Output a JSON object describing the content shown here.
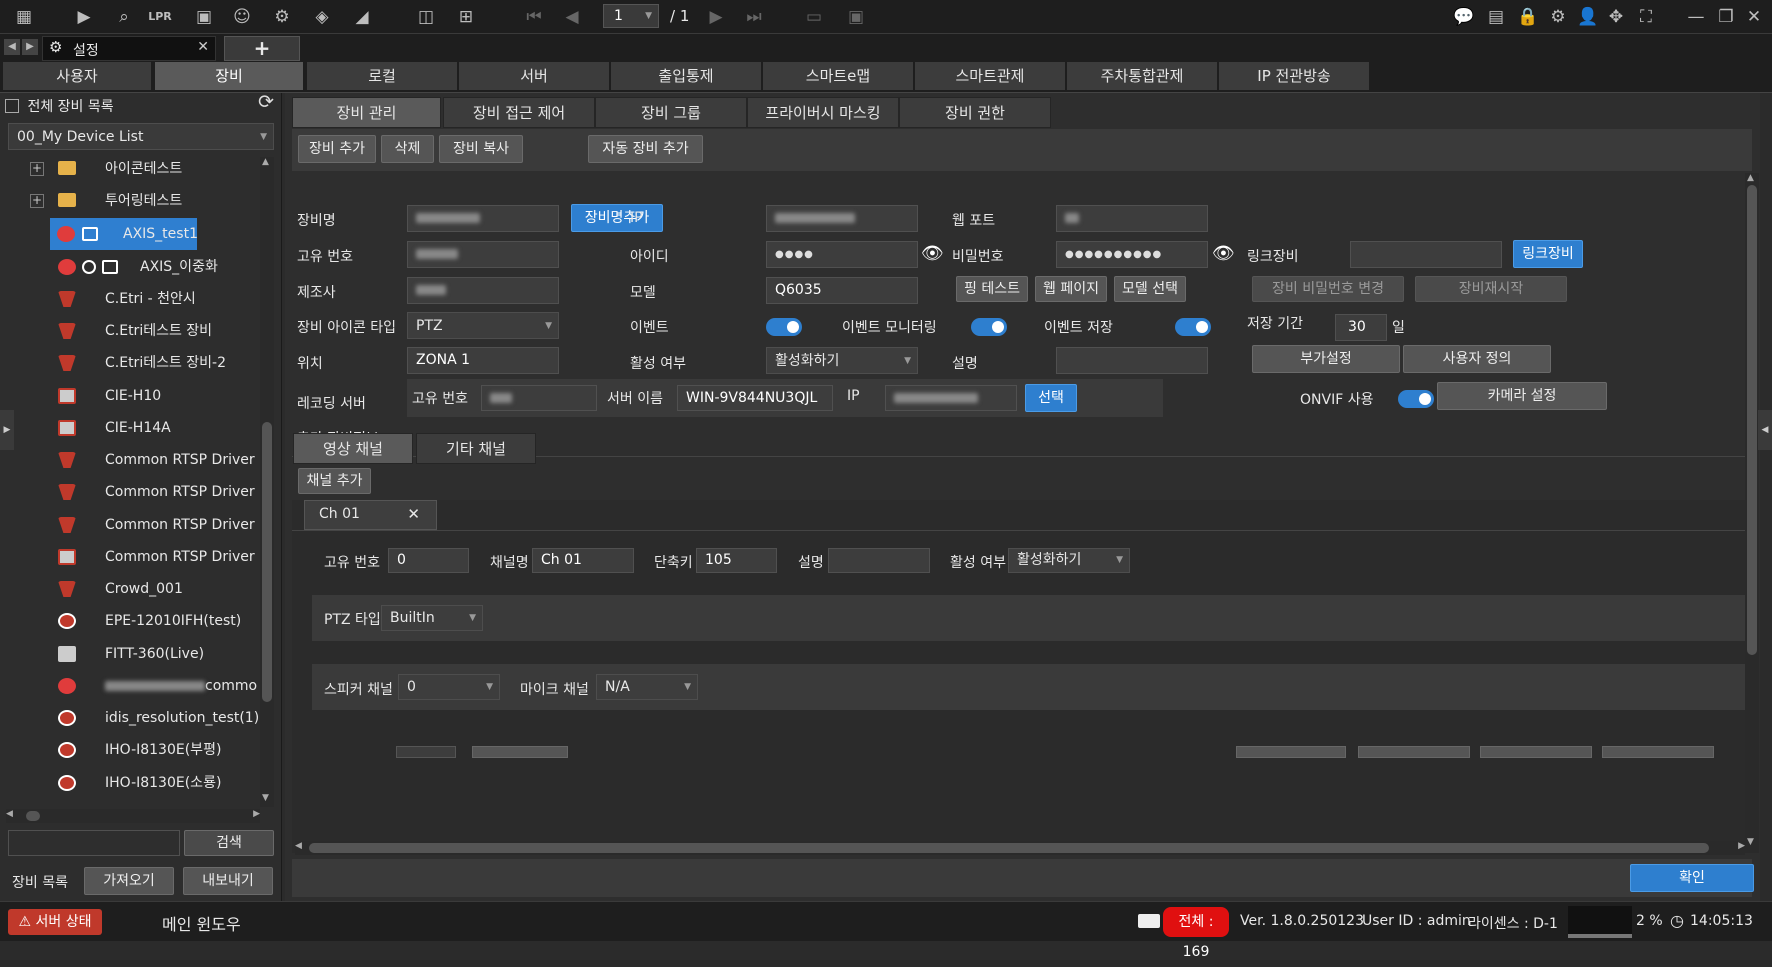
{
  "top": {
    "page": "1",
    "page_total": "/ 1"
  },
  "window_tab": {
    "title": "설정",
    "add": "+",
    "close": "✕"
  },
  "main_tabs": [
    "사용자",
    "장비",
    "로컬",
    "서버",
    "출입통제",
    "스마트e맵",
    "스마트관제",
    "주차통합관제",
    "IP 전관방송"
  ],
  "sidebar": {
    "all_devices": "전체 장비 목록",
    "device_list": "00_My Device List",
    "folders": [
      "아이콘테스트",
      "투어링테스트"
    ],
    "devices": [
      "AXIS_test1",
      "AXIS_이중화",
      "C.Etri - 천안시",
      "C.Etri테스트 장비",
      "C.Etri테스트 장비-2",
      "CIE-H10",
      "CIE-H14A",
      "Common RTSP Driver",
      "Common RTSP Driver",
      "Common RTSP Driver",
      "Common RTSP Driver",
      "Crowd_001",
      "EPE-12010IFH(test)",
      "FITT-360(Live)",
      "common",
      "idis_resolution_test(1)",
      "IHO-I8130E(부평)",
      "IHO-I8130E(소룡)"
    ],
    "search": "검색",
    "list_label": "장비 목록",
    "import": "가져오기",
    "export": "내보내기"
  },
  "sub_tabs": [
    "장비 관리",
    "장비 접근 제어",
    "장비 그룹",
    "프라이버시 마스킹",
    "장비 권한"
  ],
  "toolbar": {
    "add": "장비 추가",
    "delete": "삭제",
    "copy": "장비 복사",
    "auto_add": "자동 장비 추가"
  },
  "form": {
    "name_label": "장비명",
    "name_add": "장비명추가",
    "ip_label": "IP",
    "webport_label": "웹 포트",
    "uid_label": "고유 번호",
    "id_label": "아이디",
    "id_value": "●●●●",
    "pw_label": "비밀번호",
    "pw_value": "●●●●●●●●●●",
    "link_label": "링크장비",
    "link_btn": "링크장비",
    "maker_label": "제조사",
    "model_label": "모델",
    "model_value": "Q6035",
    "ping": "핑 테스트",
    "webpage": "웹 페이지",
    "model_select": "모델 선택",
    "pw_change": "장비 비밀번호 변경",
    "restart": "장비재시작",
    "icon_type_label": "장비 아이콘 타입",
    "icon_type_value": "PTZ",
    "event_label": "이벤트",
    "event_mon_label": "이벤트 모니터링",
    "event_save_label": "이벤트 저장",
    "keep_label": "저장 기간",
    "keep_value": "30",
    "keep_unit": "일",
    "location_label": "위치",
    "location_value": "ZONA 1",
    "active_label": "활성 여부",
    "active_value": "활성화하기",
    "desc_label": "설명",
    "extra_settings": "부가설정",
    "user_define": "사용자 정의",
    "rec_label": "레코딩 서버",
    "rec_uid_label": "고유 번호",
    "rec_server_label": "서버 이름",
    "rec_server_value": "WIN-9V844NU3QJL",
    "rec_ip_label": "IP",
    "rec_select": "선택",
    "onvif_label": "ONVIF 사용",
    "camera_settings": "카메라 설정",
    "extra_info": "추가 장비정보"
  },
  "channel_tabs": [
    "영상 채널",
    "기타 채널"
  ],
  "channel": {
    "add": "채널 추가",
    "tab": "Ch 01",
    "uid_label": "고유 번호",
    "uid_value": "0",
    "name_label": "채널명",
    "name_value": "Ch 01",
    "hotkey_label": "단축키",
    "hotkey_value": "105",
    "desc_label": "설명",
    "active_label": "활성 여부",
    "active_value": "활성화하기",
    "ptz_label": "PTZ 타입",
    "ptz_value": "BuiltIn",
    "speaker_label": "스피커 채널",
    "speaker_value": "0",
    "mic_label": "마이크 채널",
    "mic_value": "N/A"
  },
  "confirm": "확인",
  "status": {
    "server": "서버 상태",
    "main_window": "메인 윈도우",
    "total": "전체 : 169",
    "version": "Ver. 1.8.0.250123",
    "user": "User ID : admin",
    "license": "라이센스 : D-1",
    "cpu": "2 %",
    "time": "14:05:13"
  }
}
